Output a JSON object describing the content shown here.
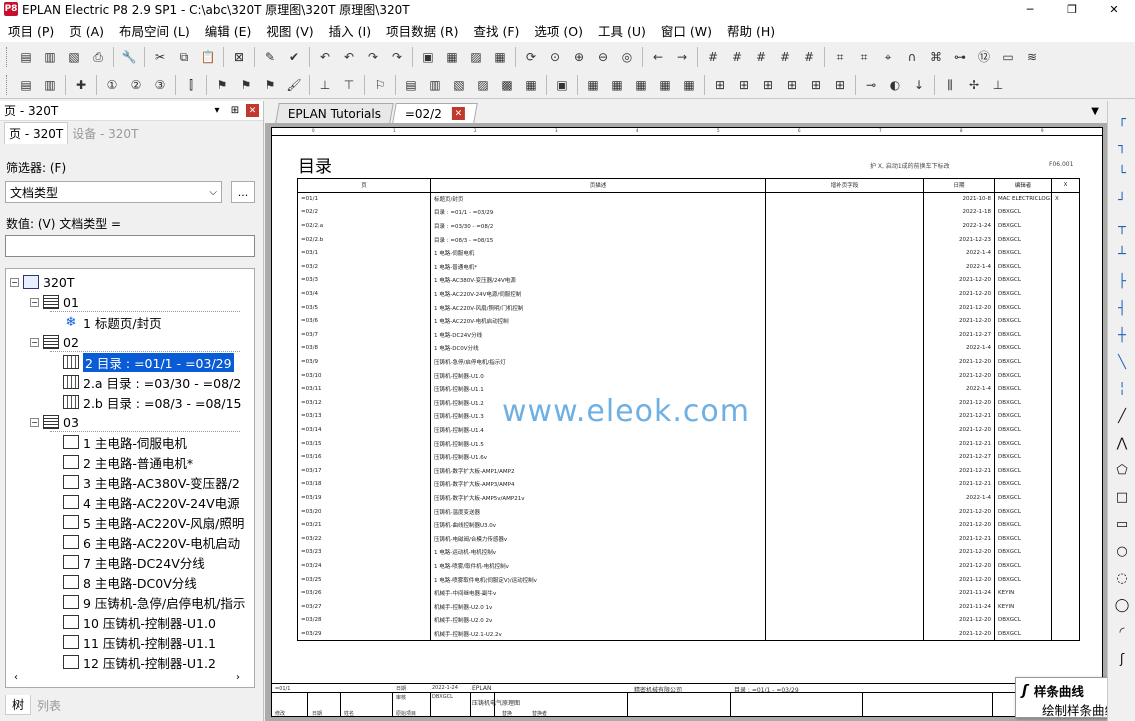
{
  "window": {
    "title": "EPLAN Electric P8 2.9 SP1 - C:\\abc\\320T 原理图\\320T 原理图\\320T",
    "controls": [
      "─",
      "❐",
      "✕"
    ]
  },
  "menu": [
    "项目 (P)",
    "页 (A)",
    "布局空间 (L)",
    "编辑 (E)",
    "视图 (V)",
    "插入 (I)",
    "项目数据 (R)",
    "查找 (F)",
    "选项 (O)",
    "工具 (U)",
    "窗口 (W)",
    "帮助 (H)"
  ],
  "toolbar1": [
    {
      "name": "new-project-icon",
      "glyph": "▤"
    },
    {
      "name": "open-project-icon",
      "glyph": "▥"
    },
    {
      "name": "page-new-icon",
      "glyph": "▧"
    },
    {
      "name": "print-icon",
      "glyph": "⎙"
    },
    {
      "name": "sep",
      "glyph": ""
    },
    {
      "name": "settings-wrench-icon",
      "glyph": "🔧"
    },
    {
      "name": "sep",
      "glyph": ""
    },
    {
      "name": "cut-icon",
      "glyph": "✂"
    },
    {
      "name": "copy-icon",
      "glyph": "⧉"
    },
    {
      "name": "paste-icon",
      "glyph": "📋"
    },
    {
      "name": "sep",
      "glyph": ""
    },
    {
      "name": "delete-icon",
      "glyph": "⊠"
    },
    {
      "name": "sep",
      "glyph": ""
    },
    {
      "name": "format-painter-icon",
      "glyph": "✎"
    },
    {
      "name": "check-icon",
      "glyph": "✔"
    },
    {
      "name": "sep",
      "glyph": ""
    },
    {
      "name": "undo-icon",
      "glyph": "↶"
    },
    {
      "name": "undo-list-icon",
      "glyph": "↶"
    },
    {
      "name": "redo-icon",
      "glyph": "↷"
    },
    {
      "name": "redo-list-icon",
      "glyph": "↷"
    },
    {
      "name": "sep",
      "glyph": ""
    },
    {
      "name": "properties-icon",
      "glyph": "▣"
    },
    {
      "name": "table-edit-icon",
      "glyph": "▦"
    },
    {
      "name": "page-props-icon",
      "glyph": "▨"
    },
    {
      "name": "grid-table-icon",
      "glyph": "▦"
    },
    {
      "name": "sep",
      "glyph": ""
    },
    {
      "name": "refresh-icon",
      "glyph": "⟳"
    },
    {
      "name": "zoom-window-icon",
      "glyph": "⊙"
    },
    {
      "name": "zoom-in-icon",
      "glyph": "⊕"
    },
    {
      "name": "zoom-out-icon",
      "glyph": "⊖"
    },
    {
      "name": "zoom-fit-icon",
      "glyph": "◎"
    },
    {
      "name": "sep",
      "glyph": ""
    },
    {
      "name": "back-arrow-icon",
      "glyph": "←"
    },
    {
      "name": "forward-arrow-icon",
      "glyph": "→"
    },
    {
      "name": "sep",
      "glyph": ""
    },
    {
      "name": "grid-a-icon",
      "glyph": "#"
    },
    {
      "name": "grid-b-icon",
      "glyph": "#"
    },
    {
      "name": "grid-c-icon",
      "glyph": "#"
    },
    {
      "name": "grid-d-icon",
      "glyph": "#"
    },
    {
      "name": "grid-e-icon",
      "glyph": "#"
    },
    {
      "name": "sep",
      "glyph": ""
    },
    {
      "name": "grid-show-icon",
      "glyph": "⌗"
    },
    {
      "name": "snap-grid-icon",
      "glyph": "⌗"
    },
    {
      "name": "snap-object-icon",
      "glyph": "⌖"
    },
    {
      "name": "magnet-icon",
      "glyph": "∩"
    },
    {
      "name": "snap-point-icon",
      "glyph": "⌘"
    },
    {
      "name": "connection-icon",
      "glyph": "⊶"
    },
    {
      "name": "numbering-icon",
      "glyph": "⑫"
    },
    {
      "name": "input-field-icon",
      "glyph": "▭"
    },
    {
      "name": "wifi-icon",
      "glyph": "≋"
    }
  ],
  "toolbar2": [
    {
      "name": "page-nav-icon",
      "glyph": "▤"
    },
    {
      "name": "page-list-icon",
      "glyph": "▥"
    },
    {
      "name": "sep",
      "glyph": ""
    },
    {
      "name": "plugin-icon",
      "glyph": "✚"
    },
    {
      "name": "sep",
      "glyph": ""
    },
    {
      "name": "number-1-icon",
      "glyph": "①"
    },
    {
      "name": "number-2-icon",
      "glyph": "②"
    },
    {
      "name": "number-3-icon",
      "glyph": "③"
    },
    {
      "name": "sep",
      "glyph": ""
    },
    {
      "name": "cable-icon",
      "glyph": "⫿"
    },
    {
      "name": "sep",
      "glyph": ""
    },
    {
      "name": "flag-green-icon",
      "glyph": "⚑"
    },
    {
      "name": "flag-blue-icon",
      "glyph": "⚑"
    },
    {
      "name": "flag-violet-icon",
      "glyph": "⚑"
    },
    {
      "name": "brush-icon",
      "glyph": "🖌"
    },
    {
      "name": "sep",
      "glyph": ""
    },
    {
      "name": "link-icon",
      "glyph": "⊥"
    },
    {
      "name": "link-down-icon",
      "glyph": "⊤"
    },
    {
      "name": "sep",
      "glyph": ""
    },
    {
      "name": "flag-delete-icon",
      "glyph": "⚐"
    },
    {
      "name": "sep",
      "glyph": ""
    },
    {
      "name": "doc-a-icon",
      "glyph": "▤"
    },
    {
      "name": "doc-b-icon",
      "glyph": "▥"
    },
    {
      "name": "doc-c-icon",
      "glyph": "▧"
    },
    {
      "name": "doc-d-icon",
      "glyph": "▨"
    },
    {
      "name": "doc-e-icon",
      "glyph": "▩"
    },
    {
      "name": "doc-f-icon",
      "glyph": "▦"
    },
    {
      "name": "sep",
      "glyph": ""
    },
    {
      "name": "macro-icon",
      "glyph": "▣"
    },
    {
      "name": "sep",
      "glyph": ""
    },
    {
      "name": "device-a-icon",
      "glyph": "▦"
    },
    {
      "name": "device-b-icon",
      "glyph": "▦"
    },
    {
      "name": "device-c-icon",
      "glyph": "▦"
    },
    {
      "name": "device-d-icon",
      "glyph": "▦"
    },
    {
      "name": "device-e-icon",
      "glyph": "▦"
    },
    {
      "name": "sep",
      "glyph": ""
    },
    {
      "name": "terminal-a-icon",
      "glyph": "⊞"
    },
    {
      "name": "terminal-b-icon",
      "glyph": "⊞"
    },
    {
      "name": "terminal-c-icon",
      "glyph": "⊞"
    },
    {
      "name": "terminal-d-icon",
      "glyph": "⊞"
    },
    {
      "name": "terminal-e-icon",
      "glyph": "⊞"
    },
    {
      "name": "terminal-f-icon",
      "glyph": "⊞"
    },
    {
      "name": "sep",
      "glyph": ""
    },
    {
      "name": "plug-icon",
      "glyph": "⊸"
    },
    {
      "name": "pin-icon",
      "glyph": "◐"
    },
    {
      "name": "arrow-down-icon",
      "glyph": "↓"
    },
    {
      "name": "sep",
      "glyph": ""
    },
    {
      "name": "wire-a-icon",
      "glyph": "⫼"
    },
    {
      "name": "wire-b-icon",
      "glyph": "✢"
    },
    {
      "name": "wire-c-icon",
      "glyph": "⊥"
    }
  ],
  "left_panel": {
    "title": "页 - 320T",
    "pin": "⊞",
    "close": "✕",
    "tabs": [
      "页 - 320T",
      "设备 - 320T"
    ],
    "filter_label": "筛选器: (F)",
    "filter_value": "文档类型",
    "filter_more": "...",
    "value_label": "数值: (V) 文档类型 =",
    "tree": [
      {
        "indent": 0,
        "expander": "−",
        "icon": "proj",
        "label": "320T",
        "selected": false
      },
      {
        "indent": 1,
        "expander": "−",
        "icon": "group",
        "label": "01",
        "selected": false
      },
      {
        "indent": 2,
        "expander": "",
        "icon": "cover",
        "label": "1 标题页/封页",
        "selected": false
      },
      {
        "indent": 1,
        "expander": "−",
        "icon": "group",
        "label": "02",
        "selected": false
      },
      {
        "indent": 2,
        "expander": "",
        "icon": "table",
        "label": "2 目录 : =01/1 - =03/29",
        "selected": true
      },
      {
        "indent": 2,
        "expander": "",
        "icon": "table",
        "label": "2.a 目录 : =03/30 - =08/2",
        "selected": false
      },
      {
        "indent": 2,
        "expander": "",
        "icon": "table",
        "label": "2.b 目录 : =08/3 - =08/15",
        "selected": false
      },
      {
        "indent": 1,
        "expander": "−",
        "icon": "group",
        "label": "03",
        "selected": false
      },
      {
        "indent": 2,
        "expander": "",
        "icon": "page",
        "label": "1 主电路-伺服电机",
        "selected": false
      },
      {
        "indent": 2,
        "expander": "",
        "icon": "page",
        "label": "2 主电路-普通电机*",
        "selected": false
      },
      {
        "indent": 2,
        "expander": "",
        "icon": "page",
        "label": "3 主电路-AC380V-变压器/2",
        "selected": false
      },
      {
        "indent": 2,
        "expander": "",
        "icon": "page",
        "label": "4 主电路-AC220V-24V电源",
        "selected": false
      },
      {
        "indent": 2,
        "expander": "",
        "icon": "page",
        "label": "5 主电路-AC220V-风扇/照明",
        "selected": false
      },
      {
        "indent": 2,
        "expander": "",
        "icon": "page",
        "label": "6 主电路-AC220V-电机启动",
        "selected": false
      },
      {
        "indent": 2,
        "expander": "",
        "icon": "page",
        "label": "7 主电路-DC24V分线",
        "selected": false
      },
      {
        "indent": 2,
        "expander": "",
        "icon": "page",
        "label": "8 主电路-DC0V分线",
        "selected": false
      },
      {
        "indent": 2,
        "expander": "",
        "icon": "page",
        "label": "9 压铸机-急停/启停电机/指示",
        "selected": false
      },
      {
        "indent": 2,
        "expander": "",
        "icon": "page",
        "label": "10 压铸机-控制器-U1.0",
        "selected": false
      },
      {
        "indent": 2,
        "expander": "",
        "icon": "page",
        "label": "11 压铸机-控制器-U1.1",
        "selected": false
      },
      {
        "indent": 2,
        "expander": "",
        "icon": "page",
        "label": "12 压铸机-控制器-U1.2",
        "selected": false
      }
    ],
    "bottom_tabs": [
      "树",
      "列表"
    ]
  },
  "doc_tabs": [
    {
      "label": "EPLAN Tutorials",
      "active": false,
      "closable": false
    },
    {
      "label": "=02/2",
      "active": true,
      "closable": true
    }
  ],
  "sheet": {
    "title": "目录",
    "note": "护 X,  启动1成的前换车下标改",
    "code": "F06.001",
    "ruler_numbers": [
      "0",
      "1",
      "2",
      "3",
      "4",
      "5",
      "6",
      "7",
      "8",
      "9"
    ],
    "columns": [
      "页",
      "页描述",
      "增补页字段",
      "日期",
      "编辑者",
      "X"
    ],
    "rows": [
      [
        "=01/1",
        "标题页/封页",
        "",
        "2021-10-8",
        "MAC ELECTRICLOG1",
        "X"
      ],
      [
        "=02/2",
        "目录 : =01/1 - =03/29",
        "",
        "2022-1-18",
        "DBXGCL",
        ""
      ],
      [
        "=02/2.a",
        "目录 : =03/30 - =08/2",
        "",
        "2022-1-24",
        "DBXGCL",
        ""
      ],
      [
        "=02/2.b",
        "目录 : =08/3 - =08/15",
        "",
        "2021-12-23",
        "DBXGCL",
        ""
      ],
      [
        "=03/1",
        "1 电路-伺服电机",
        "",
        "2022-1-4",
        "DBXGCL",
        ""
      ],
      [
        "=03/2",
        "1 电路-普通电机*",
        "",
        "2022-1-4",
        "DBXGCL",
        ""
      ],
      [
        "=03/3",
        "1 电路-AC380V-变压器/24V电源",
        "",
        "2021-12-20",
        "DBXGCL",
        ""
      ],
      [
        "=03/4",
        "1 电路-AC220V-24V电源/伺服控制",
        "",
        "2021-12-20",
        "DBXGCL",
        ""
      ],
      [
        "=03/5",
        "1 电路-AC220V-风扇/照明/门机控制",
        "",
        "2021-12-20",
        "DBXGCL",
        ""
      ],
      [
        "=03/6",
        "1 电路-AC220V-电机启动控制",
        "",
        "2021-12-20",
        "DBXGCL",
        ""
      ],
      [
        "=03/7",
        "1 电路-DC24V分线",
        "",
        "2021-12-27",
        "DBXGCL",
        ""
      ],
      [
        "=03/8",
        "1 电路-DC0V分线",
        "",
        "2022-1-4",
        "DBXGCL",
        ""
      ],
      [
        "=03/9",
        "压铸机-急停/启停电机/指示灯",
        "",
        "2021-12-20",
        "DBXGCL",
        ""
      ],
      [
        "=03/10",
        "压铸机-控制器-U1.0",
        "",
        "2021-12-20",
        "DBXGCL",
        ""
      ],
      [
        "=03/11",
        "压铸机-控制器-U1.1",
        "",
        "2022-1-4",
        "DBXGCL",
        ""
      ],
      [
        "=03/12",
        "压铸机-控制器-U1.2",
        "",
        "2021-12-20",
        "DBXGCL",
        ""
      ],
      [
        "=03/13",
        "压铸机-控制器-U1.3",
        "",
        "2021-12-21",
        "DBXGCL",
        ""
      ],
      [
        "=03/14",
        "压铸机-控制器-U1.4",
        "",
        "2021-12-20",
        "DBXGCL",
        ""
      ],
      [
        "=03/15",
        "压铸机-控制器-U1.5",
        "",
        "2021-12-21",
        "DBXGCL",
        ""
      ],
      [
        "=03/16",
        "压铸机-控制器-U1.6v",
        "",
        "2021-12-27",
        "DBXGCL",
        ""
      ],
      [
        "=03/17",
        "压铸机-数字扩大板-AMP1/AMP2",
        "",
        "2021-12-21",
        "DBXGCL",
        ""
      ],
      [
        "=03/18",
        "压铸机-数字扩大板-AMP3/AMP4",
        "",
        "2021-12-21",
        "DBXGCL",
        ""
      ],
      [
        "=03/19",
        "压铸机-数字扩大板-AMP5v/AMP21v",
        "",
        "2022-1-4",
        "DBXGCL",
        ""
      ],
      [
        "=03/20",
        "压铸机-温度变送器",
        "",
        "2021-12-20",
        "DBXGCL",
        ""
      ],
      [
        "=03/21",
        "压铸机-曲线控制器U3.0v",
        "",
        "2021-12-20",
        "DBXGCL",
        ""
      ],
      [
        "=03/22",
        "压铸机-电磁阀/合模力传感器v",
        "",
        "2021-12-21",
        "DBXGCL",
        ""
      ],
      [
        "=03/23",
        "1 电路-运动机-电机控制v",
        "",
        "2021-12-20",
        "DBXGCL",
        ""
      ],
      [
        "=03/24",
        "1 电路-喷雾/取件机-电机控制v",
        "",
        "2021-12-20",
        "DBXGCL",
        ""
      ],
      [
        "=03/25",
        "1 电路-喷雾取件电机(伺服定V)/运动控制v",
        "",
        "2021-12-20",
        "DBXGCL",
        ""
      ],
      [
        "=03/26",
        "机械手-中间继电器-副牛v",
        "",
        "2021-11-24",
        "KEYIN",
        ""
      ],
      [
        "=03/27",
        "机械手-控制器-U2.0 1v",
        "",
        "2021-11-24",
        "KEYIN",
        ""
      ],
      [
        "=03/28",
        "机械手-控制器-U2.0 2v",
        "",
        "2021-12-20",
        "DBXGCL",
        ""
      ],
      [
        "=03/29",
        "机械手-控制器-U2.1-U2.2v",
        "",
        "2021-12-20",
        "DBXGCL",
        ""
      ]
    ],
    "watermark": "www.eleok.com",
    "title_block": {
      "page_ref": "=01/1",
      "company": "EPLAN",
      "project": "压铸机电气原理图",
      "customer": "精密机械有限公司",
      "range": "目录 : =01/1 - =03/29",
      "f1": "日期",
      "f2": "2022-1-24",
      "f3": "审核",
      "f4": "DBXGCL",
      "f5": "修改",
      "f6": "日期",
      "f7": "姓名",
      "f8": "原始项目",
      "f9": "替换",
      "f10": "替换者"
    }
  },
  "tooltip": {
    "icon": "ʃ",
    "title": "样条曲线",
    "desc": "绘制样条曲线"
  },
  "right_toolbar": [
    {
      "name": "corner-top-left-icon",
      "glyph": "┌",
      "blk": false
    },
    {
      "name": "corner-top-right-icon",
      "glyph": "┐",
      "blk": false
    },
    {
      "name": "corner-bottom-left-icon",
      "glyph": "└",
      "blk": false
    },
    {
      "name": "corner-bottom-right-icon",
      "glyph": "┘",
      "blk": false
    },
    {
      "name": "tee-down-icon",
      "glyph": "┬",
      "blk": false
    },
    {
      "name": "tee-up-icon",
      "glyph": "┴",
      "blk": false
    },
    {
      "name": "tee-right-icon",
      "glyph": "├",
      "blk": false
    },
    {
      "name": "tee-left-icon",
      "glyph": "┤",
      "blk": false
    },
    {
      "name": "cross-icon",
      "glyph": "┼",
      "blk": false
    },
    {
      "name": "diagonal-icon",
      "glyph": "╲",
      "blk": false
    },
    {
      "name": "break-icon",
      "glyph": "╎",
      "blk": false
    },
    {
      "name": "line-icon",
      "glyph": "╱",
      "blk": true
    },
    {
      "name": "polyline-icon",
      "glyph": "⋀",
      "blk": true
    },
    {
      "name": "polygon-icon",
      "glyph": "⬠",
      "blk": true
    },
    {
      "name": "rectangle-icon",
      "glyph": "□",
      "blk": true
    },
    {
      "name": "rect-center-icon",
      "glyph": "▭",
      "blk": true
    },
    {
      "name": "circle-icon",
      "glyph": "○",
      "blk": true
    },
    {
      "name": "circle-dashed-icon",
      "glyph": "◌",
      "blk": true
    },
    {
      "name": "ellipse-icon",
      "glyph": "◯",
      "blk": true
    },
    {
      "name": "arc-icon",
      "glyph": "◜",
      "blk": true
    },
    {
      "name": "spline-icon",
      "glyph": "ʃ",
      "blk": true
    }
  ]
}
